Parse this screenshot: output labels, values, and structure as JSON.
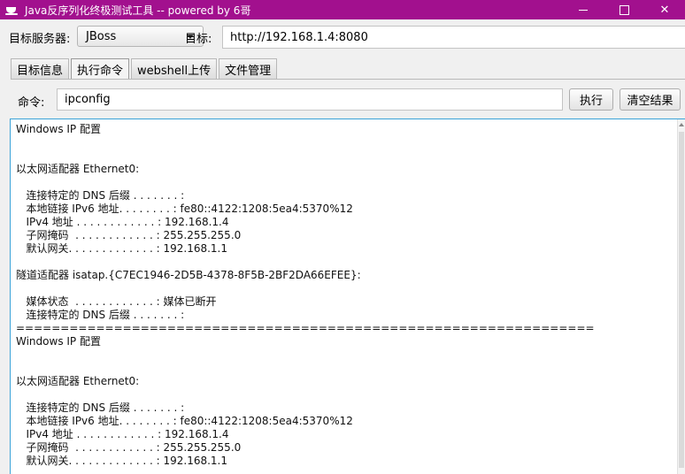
{
  "window": {
    "title": "Java反序列化终极测试工具  -- powered by 6哥",
    "minimize": "–",
    "maximize": "☐",
    "close": "✕"
  },
  "target_row": {
    "server_label": "目标服务器:",
    "server_value": "JBoss",
    "target_label": "目标:",
    "target_value": "http://192.168.1.4:8080"
  },
  "tabs": [
    {
      "label": "目标信息",
      "active": false
    },
    {
      "label": "执行命令",
      "active": true
    },
    {
      "label": "webshell上传",
      "active": false
    },
    {
      "label": "文件管理",
      "active": false
    }
  ],
  "command_row": {
    "label": "命令:",
    "value": "ipconfig",
    "execute_label": "执行",
    "clear_label": "清空结果"
  },
  "output": {
    "lines": [
      "Windows IP 配置",
      "",
      "",
      "以太网适配器 Ethernet0:",
      "",
      "   连接特定的 DNS 后缀 . . . . . . . :",
      "   本地链接 IPv6 地址. . . . . . . . : fe80::4122:1208:5ea4:5370%12",
      "   IPv4 地址 . . . . . . . . . . . . : 192.168.1.4",
      "   子网掩码  . . . . . . . . . . . . : 255.255.255.0",
      "   默认网关. . . . . . . . . . . . . : 192.168.1.1",
      "",
      "隧道适配器 isatap.{C7EC1946-2D5B-4378-8F5B-2BF2DA66EFEE}:",
      "",
      "   媒体状态  . . . . . . . . . . . . : 媒体已断开",
      "   连接特定的 DNS 后缀 . . . . . . . :",
      "=================================================================",
      "Windows IP 配置",
      "",
      "",
      "以太网适配器 Ethernet0:",
      "",
      "   连接特定的 DNS 后缀 . . . . . . . :",
      "   本地链接 IPv6 地址. . . . . . . . : fe80::4122:1208:5ea4:5370%12",
      "   IPv4 地址 . . . . . . . . . . . . : 192.168.1.4",
      "   子网掩码  . . . . . . . . . . . . : 255.255.255.0",
      "   默认网关. . . . . . . . . . . . . : 192.168.1.1"
    ]
  },
  "colors": {
    "titlebar": "#a2108e",
    "focus_border": "#3aa3d8"
  }
}
